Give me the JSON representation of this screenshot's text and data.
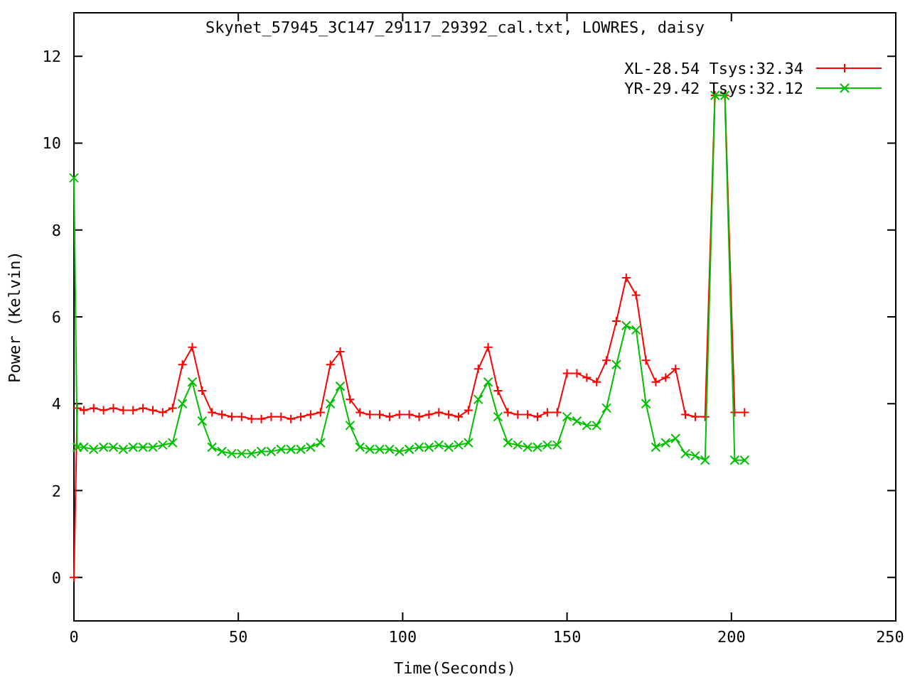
{
  "plot": {
    "chart_data": {
      "type": "line",
      "title": "Skynet_57945_3C147_29117_29392_cal.txt, LOWRES, daisy",
      "xlabel": "Time(Seconds)",
      "ylabel": "Power (Kelvin)",
      "x": [
        0,
        1,
        3,
        6,
        9,
        12,
        15,
        18,
        21,
        24,
        27,
        30,
        33,
        36,
        39,
        42,
        45,
        48,
        51,
        54,
        57,
        60,
        63,
        66,
        69,
        72,
        75,
        78,
        81,
        84,
        87,
        90,
        93,
        96,
        99,
        102,
        105,
        108,
        111,
        114,
        117,
        120,
        123,
        126,
        129,
        132,
        135,
        138,
        141,
        144,
        147,
        150,
        153,
        156,
        159,
        162,
        165,
        168,
        171,
        174,
        177,
        180,
        183,
        186,
        189,
        192,
        195,
        198,
        201,
        204
      ],
      "series": [
        {
          "name": "XL-28.54 Tsys:32.34",
          "color": "#ff0000",
          "marker": "plus",
          "values": [
            0,
            3.9,
            3.85,
            3.9,
            3.85,
            3.9,
            3.85,
            3.85,
            3.9,
            3.85,
            3.8,
            3.9,
            4.9,
            5.3,
            4.3,
            3.8,
            3.75,
            3.7,
            3.7,
            3.65,
            3.65,
            3.7,
            3.7,
            3.65,
            3.7,
            3.75,
            3.8,
            4.9,
            5.2,
            4.1,
            3.8,
            3.75,
            3.75,
            3.7,
            3.75,
            3.75,
            3.7,
            3.75,
            3.8,
            3.75,
            3.7,
            3.85,
            4.8,
            5.3,
            4.3,
            3.8,
            3.75,
            3.75,
            3.7,
            3.8,
            3.8,
            4.7,
            4.7,
            4.6,
            4.5,
            5.0,
            5.9,
            6.9,
            6.5,
            5.0,
            4.5,
            4.6,
            4.8,
            3.75,
            3.7,
            3.7,
            11.1,
            11.1,
            3.8,
            3.8
          ]
        },
        {
          "name": "YR-29.42 Tsys:32.12",
          "color": "#00c000",
          "marker": "x",
          "values": [
            9.2,
            3.0,
            3.0,
            2.95,
            3.0,
            3.0,
            2.95,
            3.0,
            3.0,
            3.0,
            3.05,
            3.1,
            4.0,
            4.5,
            3.6,
            3.0,
            2.9,
            2.85,
            2.85,
            2.85,
            2.9,
            2.9,
            2.95,
            2.95,
            2.95,
            3.0,
            3.1,
            4.0,
            4.4,
            3.5,
            3.0,
            2.95,
            2.95,
            2.95,
            2.9,
            2.95,
            3.0,
            3.0,
            3.05,
            3.0,
            3.05,
            3.1,
            4.1,
            4.5,
            3.7,
            3.1,
            3.05,
            3.0,
            3.0,
            3.05,
            3.05,
            3.7,
            3.6,
            3.5,
            3.5,
            3.9,
            4.9,
            5.8,
            5.7,
            4.0,
            3.0,
            3.1,
            3.2,
            2.85,
            2.8,
            2.7,
            11.1,
            11.1,
            2.7,
            2.7
          ]
        }
      ],
      "legend": true,
      "xlim": [
        0,
        250
      ],
      "ylim": [
        -1,
        13
      ],
      "xticks": [
        0,
        50,
        100,
        150,
        200,
        250
      ],
      "yticks": [
        0,
        2,
        4,
        6,
        8,
        10,
        12
      ]
    }
  }
}
